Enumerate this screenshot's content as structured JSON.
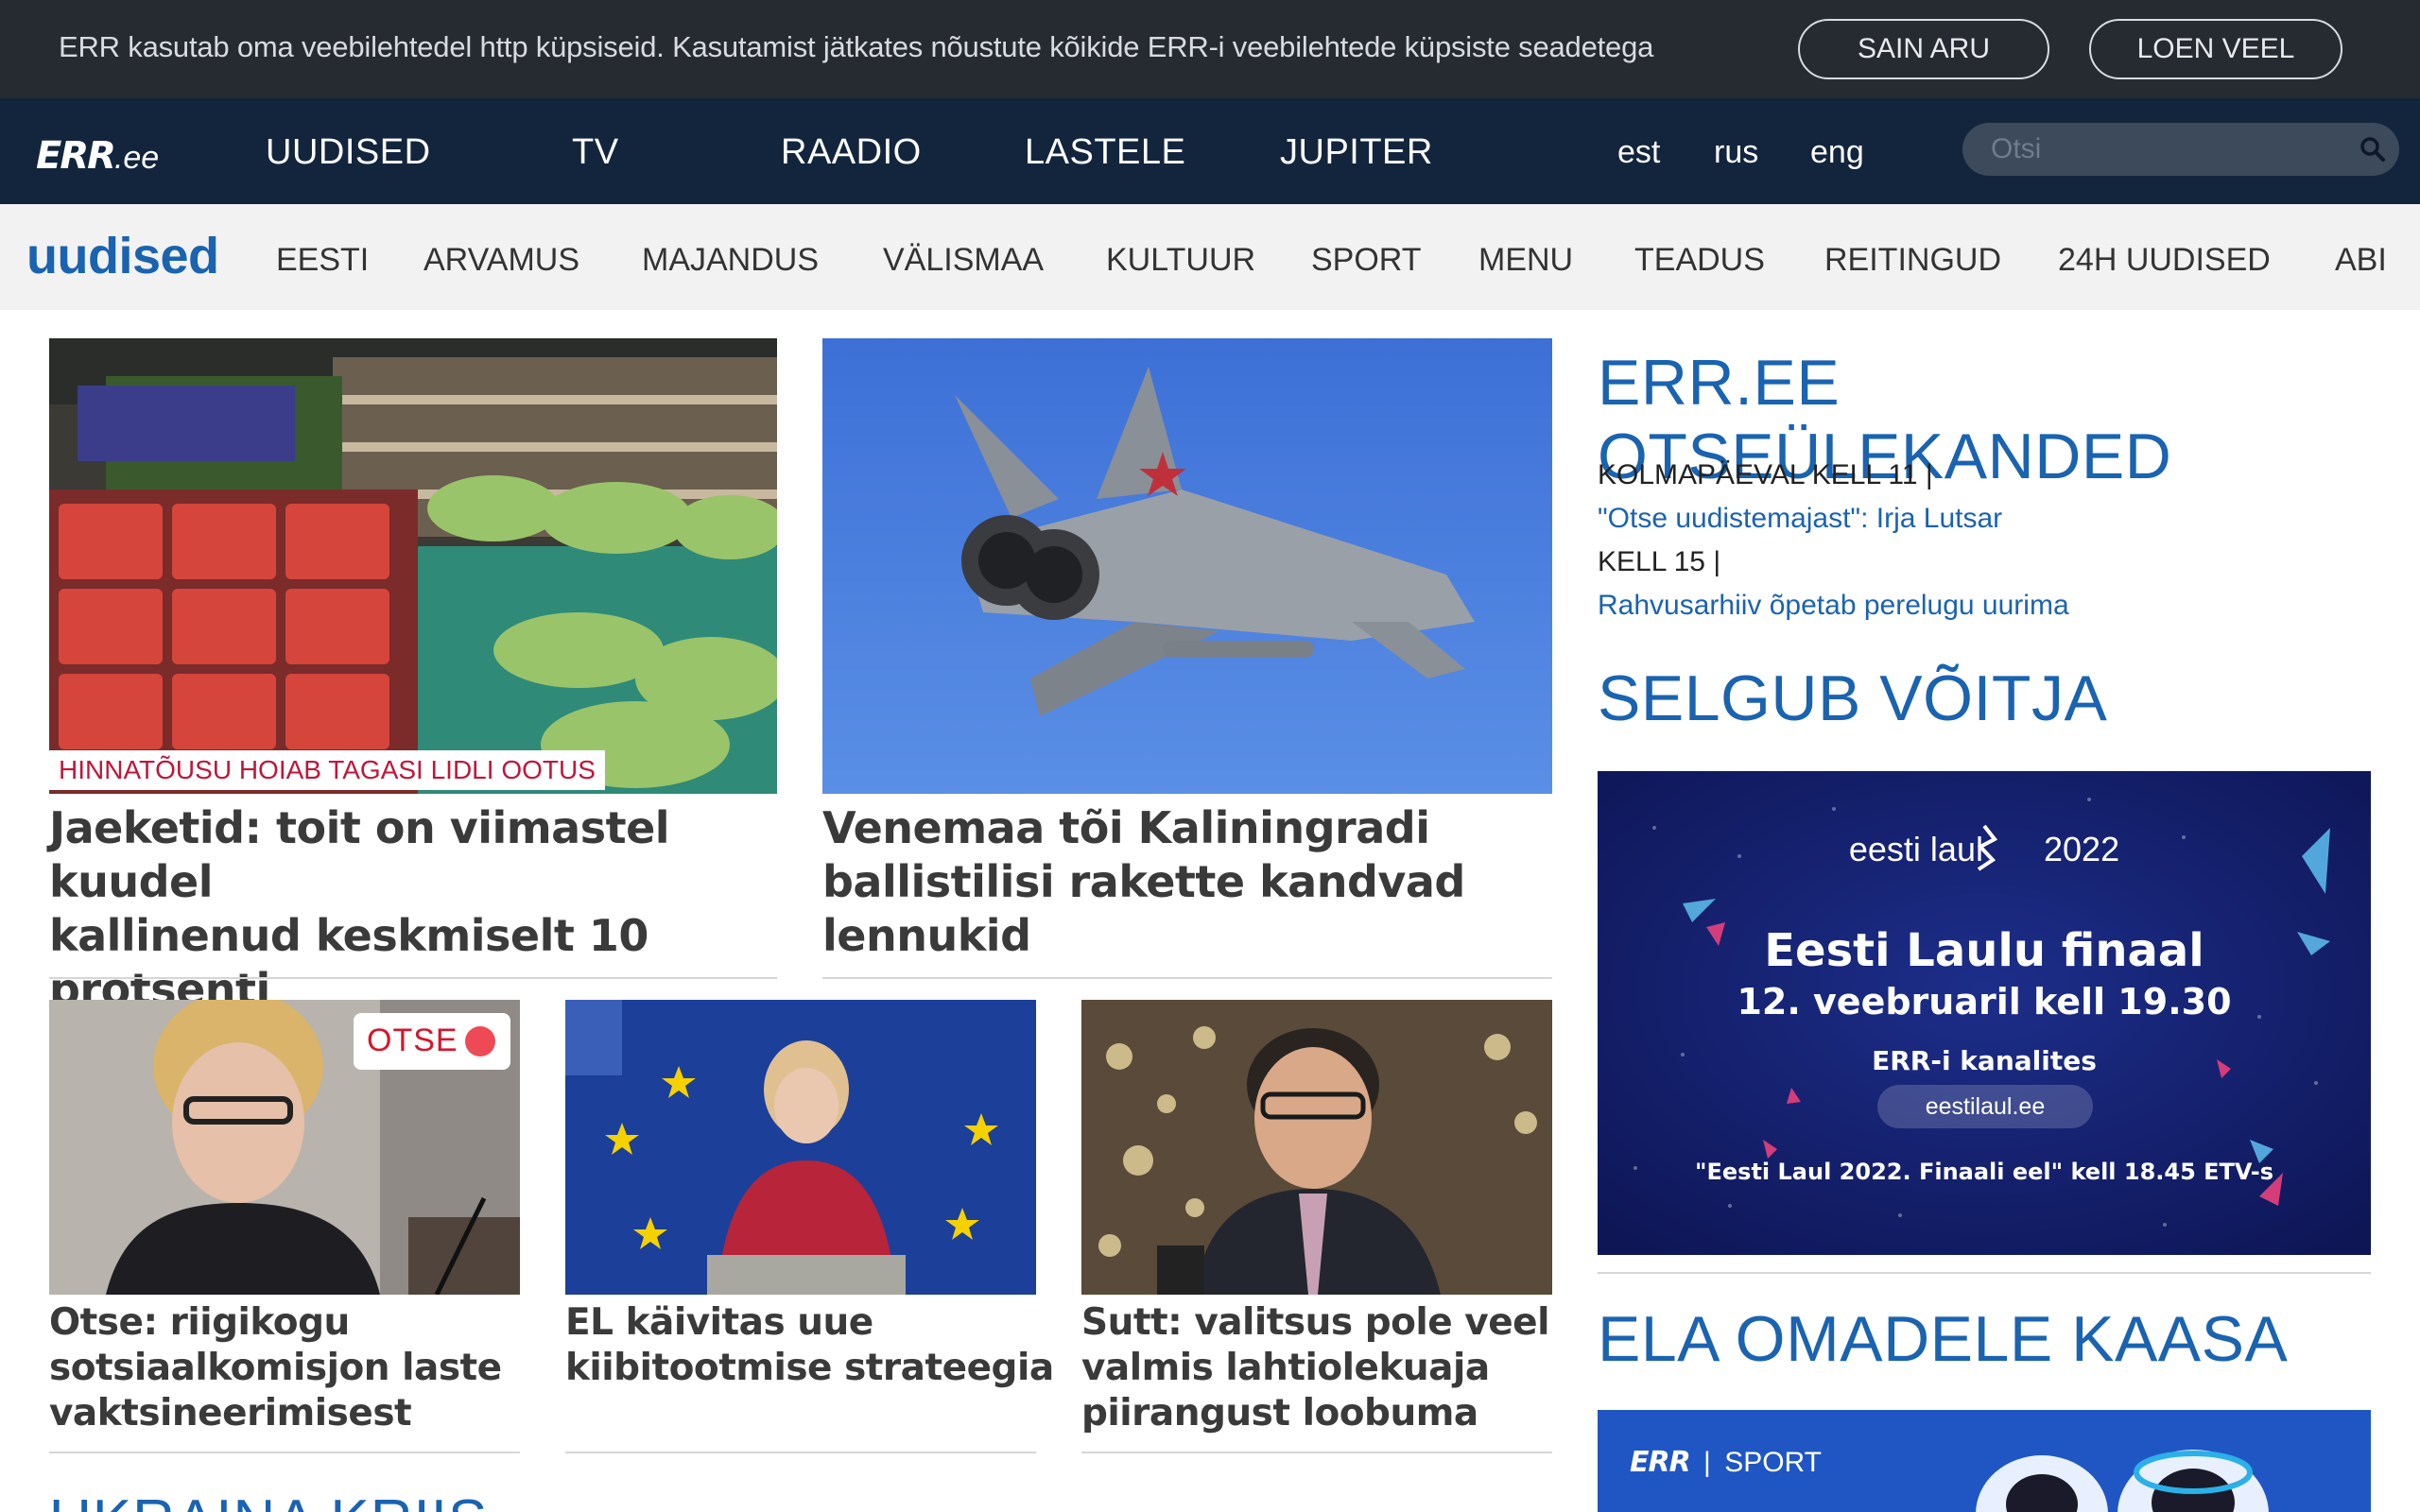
{
  "cookie_bar": {
    "text": "ERR kasutab oma veebilehtedel http küpsiseid. Kasutamist jätkates nõustute kõikide ERR-i veebilehtede küpsiste seadetega",
    "agree_label": "SAIN ARU",
    "more_label": "LOEN VEEL"
  },
  "top_nav": {
    "logo_main": "ERR",
    "logo_suffix": ".ee",
    "items": [
      "UUDISED",
      "TV",
      "RAADIO",
      "LASTELE",
      "JUPITER"
    ],
    "languages": [
      "est",
      "rus",
      "eng"
    ],
    "search_placeholder": "Otsi",
    "search_icon": "magnifier-icon"
  },
  "section_nav": {
    "title": "uudised",
    "items": [
      "EESTI",
      "ARVAMUS",
      "MAJANDUS",
      "VÄLISMAA",
      "KULTUUR",
      "SPORT",
      "MENU",
      "TEADUS",
      "REITINGUD",
      "24H UUDISED",
      "ABI"
    ]
  },
  "main": {
    "top_articles": [
      {
        "kicker": "HINNATÕUSU HOIAB TAGASI LIDLI OOTUS",
        "title_lines": [
          "Jaeketid: toit on viimastel kuudel",
          "kallinenud keskmiselt 10",
          "protsenti"
        ]
      },
      {
        "title_lines": [
          "Venemaa tõi Kaliningradi",
          "ballistilisi rakette kandvad",
          "lennukid"
        ]
      }
    ],
    "bottom_articles": [
      {
        "badge": "OTSE",
        "title_lines": [
          "Otse: riigikogu",
          "sotsiaalkomisjon laste",
          "vaktsineerimisest"
        ]
      },
      {
        "title_lines": [
          "EL käivitas uue",
          "kiibitootmise strateegia"
        ]
      },
      {
        "title_lines": [
          "Sutt: valitsus pole veel",
          "valmis lahtiolekuaja",
          "piirangust loobuma"
        ]
      }
    ],
    "next_section_heading": "UKRAINA KRIIS"
  },
  "sidebar": {
    "live_heading": "ERR.EE OTSEÜLEKANDED",
    "schedule": [
      {
        "time": "KOLMAPÄEVAL KELL 11 |",
        "program": "\"Otse uudistemajast\": Irja Lutsar"
      },
      {
        "time": "KELL 15 |",
        "program": "Rahvusarhiiv õpetab perelugu uurima"
      }
    ],
    "contest_heading": "SELGUB VÕITJA",
    "banner": {
      "brand_left": "eesti laul",
      "brand_year": "2022",
      "title": "Eesti Laulu finaal",
      "date_line": "12. veebruaril kell 19.30",
      "channels": "ERR-i kanalites",
      "website": "eestilaul.ee",
      "pre_show": "\"Eesti Laul 2022. Finaali eel\" kell 18.45 ETV-s"
    },
    "olympics_heading": "ELA OMADELE KAASA",
    "sport_logo_main": "ERR",
    "sport_logo_section": "SPORT"
  },
  "colors": {
    "cookie_bg": "#262b32",
    "topnav_bg": "#13253d",
    "section_bg": "#f2f2f2",
    "accent_blue": "#1a63b0",
    "kicker_red": "#c0163a",
    "live_red": "#d6162b",
    "banner_bg": "#14206b"
  }
}
